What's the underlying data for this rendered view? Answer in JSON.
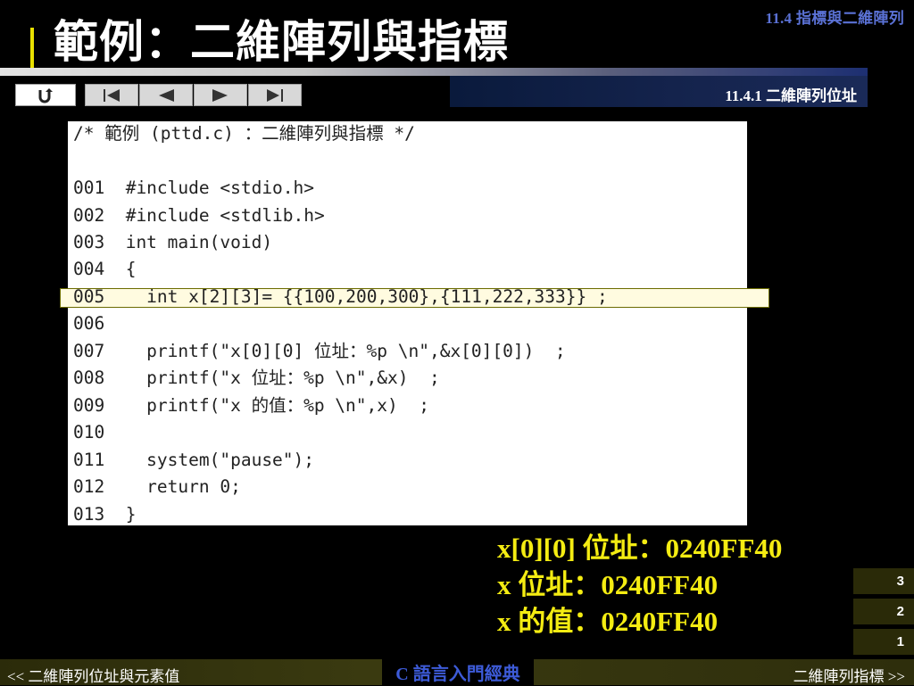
{
  "header": {
    "section": "11.4  指標與二維陣列",
    "title": "範例：二維陣列與指標",
    "subsection": "11.4.1 二維陣列位址"
  },
  "nav": {
    "icons": [
      "return-icon",
      "first-icon",
      "prev-icon",
      "next-icon",
      "last-icon"
    ]
  },
  "code": {
    "lines": [
      "/* 範例 (pttd.c) ：二維陣列與指標 */",
      "",
      "001  #include <stdio.h>",
      "002  #include <stdlib.h>",
      "003  int main(void)",
      "004  {",
      "005    int x[2][3]= {{100,200,300},{111,222,333}} ;",
      "006",
      "007    printf(\"x[0][0] 位址：%p \\n\",&x[0][0])  ;",
      "008    printf(\"x 位址：%p \\n\",&x)  ;",
      "009    printf(\"x 的值：%p \\n\",x)  ;",
      "010",
      "011    system(\"pause\");",
      "012    return 0;",
      "013  }"
    ],
    "highlighted_line": "005"
  },
  "output": {
    "lines": [
      "x[0][0] 位址：0240FF40",
      "x 位址：0240FF40",
      "x 的值：0240FF40"
    ]
  },
  "pages": [
    "3",
    "2",
    "1"
  ],
  "footer": {
    "prev": "<< 二維陣列位址與元素值",
    "book": "C 語言入門經典",
    "next": "二維陣列指標 >>"
  },
  "colors": {
    "accent_yellow": "#f4ec12",
    "section_blue": "#5b72d6",
    "book_blue": "#3d5bd8"
  }
}
